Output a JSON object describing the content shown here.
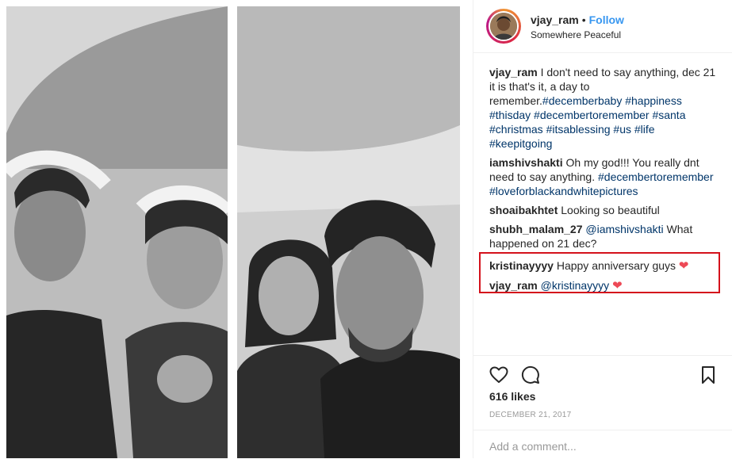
{
  "post": {
    "username": "vjay_ram",
    "follow_label": "Follow",
    "dot": "•",
    "location": "Somewhere Peaceful"
  },
  "comments": [
    {
      "user": "vjay_ram",
      "text": " I don't need to say anything, dec 21 it is that's it, a day to remember.",
      "tags": [
        "#decemberbaby",
        "#happiness",
        "#thisday",
        "#decembertoremember",
        "#santa",
        "#christmas",
        "#itsablessing",
        "#us",
        "#life",
        "#keepitgoing"
      ]
    },
    {
      "user": "iamshivshakti",
      "text": " Oh my god!!! You really dnt need to say anything. ",
      "tags": [
        "#decembertoremember",
        "#loveforblackandwhitepictures"
      ]
    },
    {
      "user": "shoaibakhtet",
      "text": " Looking so beautiful"
    },
    {
      "user": "shubh_malam_27",
      "mention": "@iamshivshakti",
      "text": " What happened on 21 dec?"
    },
    {
      "user": "kristinayyyy",
      "text": " Happy anniversary guys ",
      "heart": "❤"
    },
    {
      "user": "vjay_ram",
      "mention": "@kristinayyyy",
      "heart": "❤"
    }
  ],
  "actions": {
    "like_icon": "heart-outline-icon",
    "comment_icon": "comment-bubble-icon",
    "save_icon": "bookmark-icon"
  },
  "likes": "616 likes",
  "date": "DECEMBER 21, 2017",
  "add_comment_placeholder": "Add a comment..."
}
